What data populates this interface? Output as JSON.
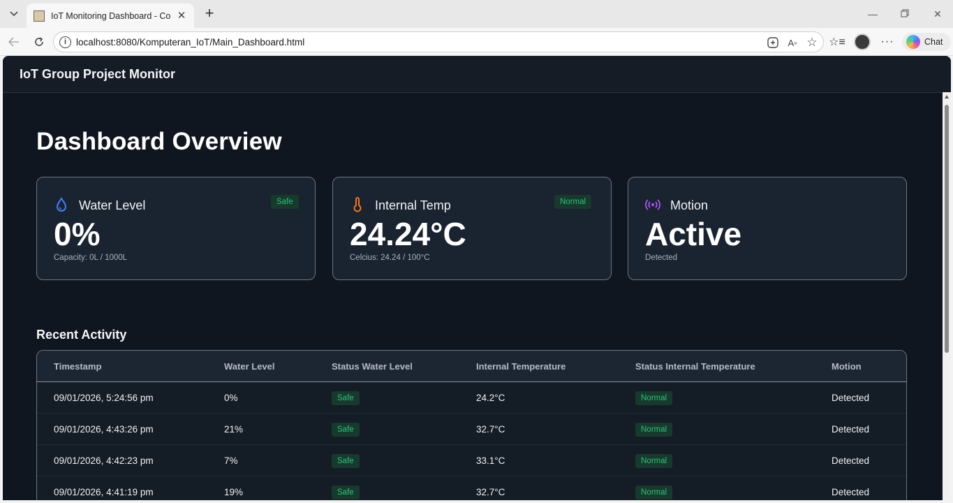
{
  "browser": {
    "tab_title": "IoT Monitoring Dashboard - Core",
    "url": "localhost:8080/Komputeran_IoT/Main_Dashboard.html",
    "chat_label": "Chat"
  },
  "app": {
    "title": "IoT Group Project Monitor",
    "page_title": "Dashboard Overview"
  },
  "cards": [
    {
      "label": "Water Level",
      "value": "0%",
      "sub": "Capacity: 0L / 1000L",
      "badge": "Safe",
      "icon": "water-drop-icon",
      "icon_color": "#3b82f6"
    },
    {
      "label": "Internal Temp",
      "value": "24.24°C",
      "sub": "Celcius: 24.24 / 100°C",
      "badge": "Normal",
      "icon": "thermometer-icon",
      "icon_color": "#f97316"
    },
    {
      "label": "Motion",
      "value": "Active",
      "sub": "Detected",
      "badge": "",
      "icon": "motion-sensor-icon",
      "icon_color": "#a855f7"
    }
  ],
  "activity": {
    "title": "Recent Activity",
    "columns": [
      "Timestamp",
      "Water Level",
      "Status Water Level",
      "Internal Temperature",
      "Status Internal Temperature",
      "Motion"
    ],
    "rows": [
      [
        "09/01/2026, 5:24:56 pm",
        "0%",
        "Safe",
        "24.2°C",
        "Normal",
        "Detected"
      ],
      [
        "09/01/2026, 4:43:26 pm",
        "21%",
        "Safe",
        "32.7°C",
        "Normal",
        "Detected"
      ],
      [
        "09/01/2026, 4:42:23 pm",
        "7%",
        "Safe",
        "33.1°C",
        "Normal",
        "Detected"
      ],
      [
        "09/01/2026, 4:41:19 pm",
        "19%",
        "Safe",
        "32.7°C",
        "Normal",
        "Detected"
      ]
    ]
  },
  "colors": {
    "background": "#0f161f",
    "card": "#1a2330",
    "status_green": "#2ec27e"
  }
}
